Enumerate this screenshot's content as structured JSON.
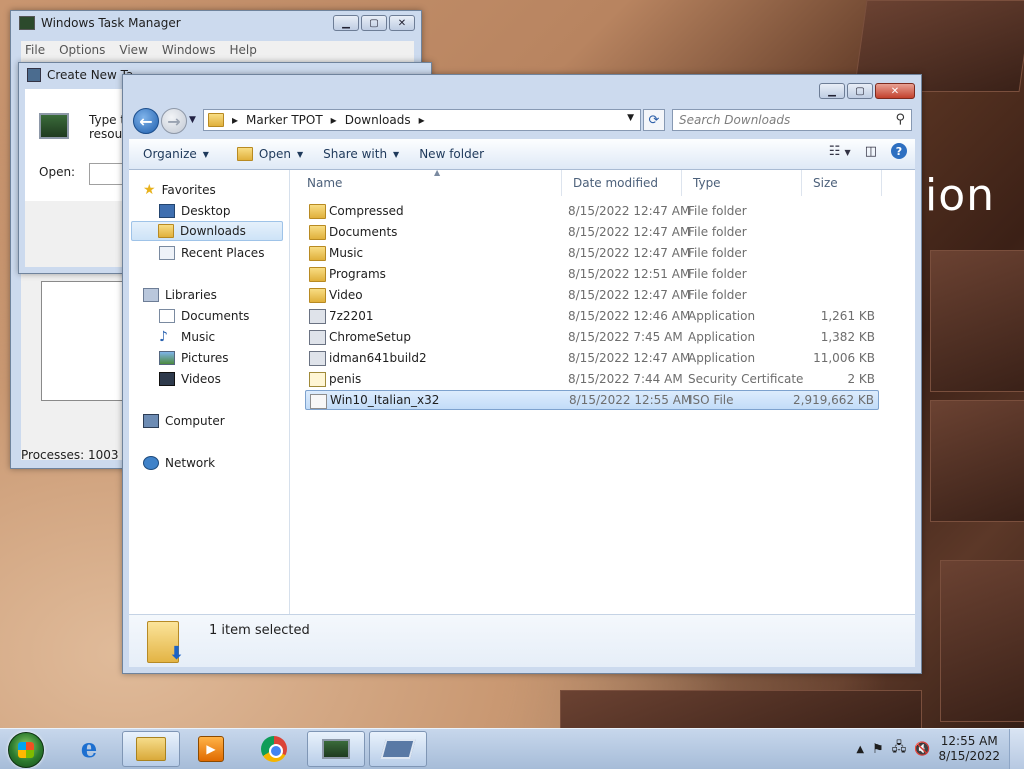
{
  "desktop": {
    "wallpaper_text": "ion"
  },
  "task_manager": {
    "title": "Windows Task Manager",
    "menu": [
      "File",
      "Options",
      "View",
      "Windows",
      "Help"
    ],
    "status_processes": "Processes: 1003"
  },
  "create_task": {
    "title": "Create New Ta",
    "body_line1": "Type t",
    "body_line2": "resour",
    "open_label": "Open:"
  },
  "explorer": {
    "breadcrumb": [
      "Marker TPOT",
      "Downloads"
    ],
    "search_placeholder": "Search Downloads",
    "commands": {
      "organize": "Organize",
      "open": "Open",
      "share_with": "Share with",
      "new_folder": "New folder"
    },
    "nav": {
      "favorites": "Favorites",
      "desktop": "Desktop",
      "downloads": "Downloads",
      "recent_places": "Recent Places",
      "libraries": "Libraries",
      "documents": "Documents",
      "music": "Music",
      "pictures": "Pictures",
      "videos": "Videos",
      "computer": "Computer",
      "network": "Network"
    },
    "columns": {
      "name": "Name",
      "date": "Date modified",
      "type": "Type",
      "size": "Size"
    },
    "files": [
      {
        "name": "Compressed",
        "date": "8/15/2022 12:47 AM",
        "type": "File folder",
        "size": "",
        "icon": "folder-icon"
      },
      {
        "name": "Documents",
        "date": "8/15/2022 12:47 AM",
        "type": "File folder",
        "size": "",
        "icon": "folder-icon"
      },
      {
        "name": "Music",
        "date": "8/15/2022 12:47 AM",
        "type": "File folder",
        "size": "",
        "icon": "folder-icon"
      },
      {
        "name": "Programs",
        "date": "8/15/2022 12:51 AM",
        "type": "File folder",
        "size": "",
        "icon": "folder-icon"
      },
      {
        "name": "Video",
        "date": "8/15/2022 12:47 AM",
        "type": "File folder",
        "size": "",
        "icon": "folder-icon"
      },
      {
        "name": "7z2201",
        "date": "8/15/2022 12:46 AM",
        "type": "Application",
        "size": "1,261 KB",
        "icon": "7zip-icon"
      },
      {
        "name": "ChromeSetup",
        "date": "8/15/2022 7:45 AM",
        "type": "Application",
        "size": "1,382 KB",
        "icon": "setup-icon"
      },
      {
        "name": "idman641build2",
        "date": "8/15/2022 12:47 AM",
        "type": "Application",
        "size": "11,006 KB",
        "icon": "idm-icon"
      },
      {
        "name": "penis",
        "date": "8/15/2022 7:44 AM",
        "type": "Security Certificate",
        "size": "2 KB",
        "icon": "certificate-icon"
      },
      {
        "name": "Win10_Italian_x32",
        "date": "8/15/2022 12:55 AM",
        "type": "ISO File",
        "size": "2,919,662 KB",
        "icon": "iso-file-icon"
      }
    ],
    "selected_index": 9,
    "status_selected": "1 item selected"
  },
  "taskbar": {
    "clock_time": "12:55 AM",
    "clock_date": "8/15/2022"
  }
}
